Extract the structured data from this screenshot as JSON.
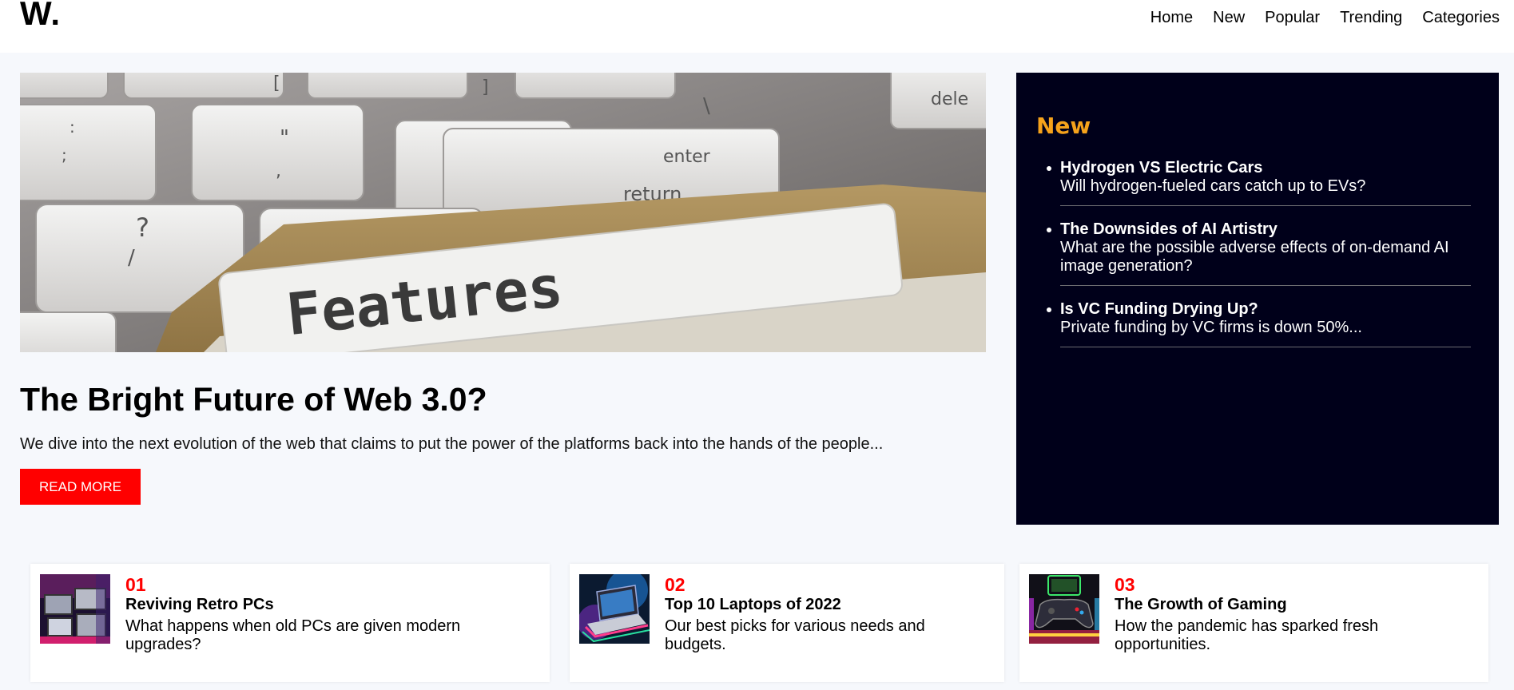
{
  "header": {
    "logo": "W.",
    "nav": [
      "Home",
      "New",
      "Popular",
      "Trending",
      "Categories"
    ]
  },
  "hero": {
    "image_label": "Features",
    "title": "The Bright Future of Web 3.0?",
    "description": "We dive into the next evolution of the web that claims to put the power of the platforms back into the hands of the people...",
    "button_label": "READ MORE"
  },
  "new_panel": {
    "heading": "New",
    "items": [
      {
        "title": "Hydrogen VS Electric Cars",
        "desc": "Will hydrogen-fueled cars catch up to EVs?"
      },
      {
        "title": "The Downsides of AI Artistry",
        "desc": "What are the possible adverse effects of on-demand AI image generation?"
      },
      {
        "title": "Is VC Funding Drying Up?",
        "desc": "Private funding by VC firms is down 50%..."
      }
    ]
  },
  "cards": [
    {
      "num": "01",
      "title": "Reviving Retro PCs",
      "desc": "What happens when old PCs are given modern upgrades?"
    },
    {
      "num": "02",
      "title": "Top 10 Laptops of 2022",
      "desc": "Our best picks for various needs and budgets."
    },
    {
      "num": "03",
      "title": "The Growth of Gaming",
      "desc": "How the pandemic has sparked fresh opportunities."
    }
  ],
  "colors": {
    "accent": "#ff0000",
    "panel_bg": "#00001a",
    "panel_heading": "#f5a21b",
    "page_bg": "#f6f8fc"
  }
}
